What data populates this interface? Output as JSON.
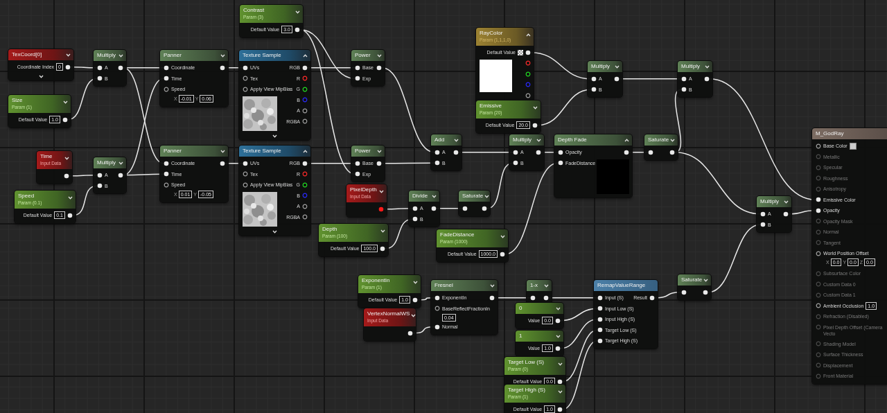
{
  "nodes": [
    {
      "kind": "input",
      "title": "TexCoord[0]",
      "expanded": false,
      "more": true,
      "outputs": [
        {
          "label": "Coordinate Index",
          "value": "0",
          "connected": true
        }
      ]
    },
    {
      "kind": "param",
      "title": "Size",
      "subtitle": "Param (1)",
      "expanded": false,
      "outputs": [
        {
          "label": "Default Value",
          "value": "1.0",
          "connected": true
        }
      ]
    },
    {
      "kind": "op",
      "title": "Multiply",
      "expanded": false,
      "inputs": [
        {
          "label": "A",
          "connected": true
        },
        {
          "label": "B",
          "connected": true
        }
      ],
      "outputs": [
        {
          "connected": true
        }
      ]
    },
    {
      "kind": "input",
      "title": "Time",
      "subtitle": "Input Data",
      "expanded": false,
      "outputs": [
        {
          "connected": true
        }
      ]
    },
    {
      "kind": "op",
      "title": "Multiply",
      "expanded": false,
      "inputs": [
        {
          "label": "A",
          "connected": true
        },
        {
          "label": "B",
          "connected": true
        }
      ],
      "outputs": [
        {
          "connected": true
        }
      ]
    },
    {
      "kind": "param",
      "title": "Speed",
      "subtitle": "Param (0.1)",
      "expanded": false,
      "outputs": [
        {
          "label": "Default Value",
          "value": "0.1",
          "connected": true
        }
      ]
    },
    {
      "kind": "op",
      "title": "Panner",
      "expanded": false,
      "inputs": [
        {
          "label": "Coordinate",
          "connected": true
        },
        {
          "label": "Time",
          "connected": true
        },
        {
          "label": "Speed",
          "connected": false,
          "fields": [
            {
              "label": "X",
              "value": "-0.01"
            },
            {
              "label": "Y",
              "value": "0.06"
            }
          ]
        }
      ],
      "outputs": [
        {
          "connected": true
        }
      ]
    },
    {
      "kind": "op",
      "title": "Panner",
      "expanded": false,
      "inputs": [
        {
          "label": "Coordinate",
          "connected": true
        },
        {
          "label": "Time",
          "connected": true
        },
        {
          "label": "Speed",
          "connected": false,
          "fields": [
            {
              "label": "X",
              "value": "0.01"
            },
            {
              "label": "Y",
              "value": "-0.05"
            }
          ]
        }
      ],
      "outputs": [
        {
          "connected": true
        }
      ]
    },
    {
      "kind": "param",
      "title": "Contrast",
      "subtitle": "Param (3)",
      "expanded": false,
      "outputs": [
        {
          "label": "Default Value",
          "value": "3.0",
          "connected": true
        }
      ]
    },
    {
      "kind": "texture",
      "title": "Texture Sample",
      "expanded": true,
      "more": true,
      "inputs": [
        {
          "label": "UVs",
          "connected": true
        },
        {
          "label": "Tex",
          "connected": false
        },
        {
          "label": "Apply View MipBias",
          "connected": false
        }
      ],
      "outputs": [
        {
          "label": "RGB",
          "connected": true
        },
        {
          "label": "R",
          "connected": false,
          "color": "#ff2a2a"
        },
        {
          "label": "G",
          "connected": false,
          "color": "#22dd22"
        },
        {
          "label": "B",
          "connected": false,
          "color": "#2a2aff"
        },
        {
          "label": "A",
          "connected": false
        },
        {
          "label": "RGBA",
          "connected": false
        }
      ]
    },
    {
      "kind": "texture",
      "title": "Texture Sample",
      "expanded": true,
      "more": true,
      "inputs": [
        {
          "label": "UVs",
          "connected": true
        },
        {
          "label": "Tex",
          "connected": false
        },
        {
          "label": "Apply View MipBias",
          "connected": false
        }
      ],
      "outputs": [
        {
          "label": "RGB",
          "connected": true
        },
        {
          "label": "R",
          "connected": false,
          "color": "#ff2a2a"
        },
        {
          "label": "G",
          "connected": false,
          "color": "#22dd22"
        },
        {
          "label": "B",
          "connected": false,
          "color": "#2a2aff"
        },
        {
          "label": "A",
          "connected": false
        },
        {
          "label": "RGBA",
          "connected": false
        }
      ]
    },
    {
      "kind": "op",
      "title": "Power",
      "expanded": false,
      "inputs": [
        {
          "label": "Base",
          "connected": true
        },
        {
          "label": "Exp",
          "connected": true
        }
      ],
      "outputs": [
        {
          "connected": true
        }
      ]
    },
    {
      "kind": "op",
      "title": "Power",
      "expanded": false,
      "inputs": [
        {
          "label": "Base",
          "connected": true
        },
        {
          "label": "Exp",
          "connected": true
        }
      ],
      "outputs": [
        {
          "connected": true
        }
      ]
    },
    {
      "kind": "op",
      "title": "Add",
      "expanded": false,
      "inputs": [
        {
          "label": "A",
          "connected": true
        },
        {
          "label": "B",
          "connected": true
        }
      ],
      "outputs": [
        {
          "connected": true
        }
      ]
    },
    {
      "kind": "input",
      "title": "PixelDepth",
      "subtitle": "Input Data",
      "expanded": false,
      "outputs": [
        {
          "connected": true,
          "color": "#ff1a1a"
        }
      ]
    },
    {
      "kind": "op",
      "title": "Divide",
      "expanded": false,
      "inputs": [
        {
          "label": "A",
          "connected": true
        },
        {
          "label": "B",
          "connected": true
        }
      ],
      "outputs": [
        {
          "connected": true
        }
      ]
    },
    {
      "kind": "op",
      "title": "Saturate",
      "expanded": false,
      "inputs": [
        {
          "connected": true
        }
      ],
      "outputs": [
        {
          "connected": true
        }
      ]
    },
    {
      "kind": "param",
      "title": "Depth",
      "subtitle": "Param (100)",
      "expanded": false,
      "outputs": [
        {
          "label": "Default Value",
          "value": "100.0",
          "connected": true
        }
      ]
    },
    {
      "kind": "param",
      "title": "FadeDistance",
      "subtitle": "Param (1000)",
      "expanded": false,
      "outputs": [
        {
          "label": "Default Value",
          "value": "1000.0",
          "connected": true
        }
      ]
    },
    {
      "kind": "vector",
      "title": "RayColor",
      "subtitle": "Param (1,1,1,0)",
      "expanded": true,
      "preview": {
        "kind": "swatch",
        "color": "#ffffff"
      },
      "outputs": [
        {
          "label": "Default Value",
          "kind": "checker",
          "connected": true
        },
        {
          "connected": false,
          "color": "#ff2a2a"
        },
        {
          "connected": false,
          "color": "#22dd22"
        },
        {
          "connected": false,
          "color": "#2a2aff"
        },
        {
          "connected": false
        }
      ]
    },
    {
      "kind": "param",
      "title": "Emissive",
      "subtitle": "Param (20)",
      "expanded": false,
      "outputs": [
        {
          "label": "Default Value",
          "value": "20.0",
          "connected": true
        }
      ]
    },
    {
      "kind": "op",
      "title": "Multiply",
      "expanded": false,
      "inputs": [
        {
          "label": "A",
          "connected": true
        },
        {
          "label": "B",
          "connected": true
        }
      ],
      "outputs": [
        {
          "connected": true
        }
      ]
    },
    {
      "kind": "op",
      "title": "Multiply",
      "expanded": false,
      "inputs": [
        {
          "label": "A",
          "connected": true
        },
        {
          "label": "B",
          "connected": true
        }
      ],
      "outputs": [
        {
          "connected": true
        }
      ]
    },
    {
      "kind": "op",
      "title": "Depth Fade",
      "expanded": true,
      "preview": {
        "kind": "swatch",
        "color": "#000000"
      },
      "inputs": [
        {
          "label": "Opacity",
          "connected": true
        },
        {
          "label": "FadeDistance",
          "connected": true
        }
      ],
      "outputs": [
        {
          "connected": true
        }
      ]
    },
    {
      "kind": "op",
      "title": "Saturate",
      "expanded": false,
      "inputs": [
        {
          "connected": true
        }
      ],
      "outputs": [
        {
          "connected": true
        }
      ]
    },
    {
      "kind": "op",
      "title": "Multiply",
      "expanded": false,
      "inputs": [
        {
          "label": "A",
          "connected": true
        },
        {
          "label": "B",
          "connected": true
        }
      ],
      "outputs": [
        {
          "connected": true
        }
      ]
    },
    {
      "kind": "op",
      "title": "Multiply",
      "expanded": false,
      "inputs": [
        {
          "label": "A",
          "connected": true
        },
        {
          "label": "B",
          "connected": true
        }
      ],
      "outputs": [
        {
          "connected": true
        }
      ]
    },
    {
      "kind": "param",
      "title": "ExponentIn",
      "subtitle": "Param (1)",
      "expanded": false,
      "outputs": [
        {
          "label": "Default Value",
          "value": "1.0",
          "connected": true
        }
      ]
    },
    {
      "kind": "input",
      "title": "VertexNormalWS",
      "subtitle": "Input Data",
      "expanded": false,
      "outputs": [
        {
          "connected": true
        }
      ]
    },
    {
      "kind": "op",
      "title": "Fresnel",
      "expanded": false,
      "inputs": [
        {
          "label": "ExponentIn",
          "connected": true
        },
        {
          "label": "BaseReflectFractionIn",
          "value": "0.04",
          "connected": false
        },
        {
          "label": "Normal",
          "connected": true
        }
      ],
      "outputs": [
        {
          "connected": true
        }
      ]
    },
    {
      "kind": "op",
      "title": "1-x",
      "expanded": false,
      "inputs": [
        {
          "connected": true
        }
      ],
      "outputs": [
        {
          "connected": true
        }
      ]
    },
    {
      "kind": "const",
      "title": "0",
      "expanded": false,
      "outputs": [
        {
          "label": "Value",
          "value": "0.0",
          "connected": true
        }
      ]
    },
    {
      "kind": "const",
      "title": "1",
      "expanded": false,
      "outputs": [
        {
          "label": "Value",
          "value": "1.0",
          "connected": true
        }
      ]
    },
    {
      "kind": "param",
      "title": "Target Low (S)",
      "subtitle": "Param (0)",
      "expanded": false,
      "outputs": [
        {
          "label": "Default Value",
          "value": "0.0",
          "connected": true
        }
      ]
    },
    {
      "kind": "param",
      "title": "Target High (S)",
      "subtitle": "Param (1)",
      "expanded": false,
      "outputs": [
        {
          "label": "Default Value",
          "value": "1.0",
          "connected": true
        }
      ]
    },
    {
      "kind": "function",
      "title": "RemapValueRange",
      "inputs": [
        {
          "label": "Input (S)",
          "connected": true
        },
        {
          "label": "Input Low (S)",
          "connected": true
        },
        {
          "label": "Input High (S)",
          "connected": true
        },
        {
          "label": "Target Low (S)",
          "connected": true
        },
        {
          "label": "Target High (S)",
          "connected": true
        }
      ],
      "outputs": [
        {
          "label": "Result",
          "connected": true
        }
      ]
    },
    {
      "kind": "op",
      "title": "Saturate",
      "expanded": false,
      "inputs": [
        {
          "connected": true
        }
      ],
      "outputs": [
        {
          "connected": true
        }
      ]
    },
    {
      "kind": "material",
      "title": "M_GodRay",
      "inputs": [
        {
          "label": "Base Color",
          "kind": "swatch",
          "color": "#cccccc",
          "connected": false,
          "disabled": false
        },
        {
          "label": "Metallic",
          "connected": false,
          "disabled": true
        },
        {
          "label": "Specular",
          "connected": false,
          "disabled": true
        },
        {
          "label": "Roughness",
          "connected": false,
          "disabled": true
        },
        {
          "label": "Anisotropy",
          "connected": false,
          "disabled": true
        },
        {
          "label": "Emissive Color",
          "connected": true,
          "disabled": false
        },
        {
          "label": "Opacity",
          "connected": true,
          "disabled": false
        },
        {
          "label": "Opacity Mask",
          "connected": false,
          "disabled": true
        },
        {
          "label": "Normal",
          "connected": false,
          "disabled": true
        },
        {
          "label": "Tangent",
          "connected": false,
          "disabled": true
        },
        {
          "label": "World Position Offset",
          "connected": false,
          "disabled": false,
          "fields": [
            {
              "label": "X",
              "value": "0.0"
            },
            {
              "label": "Y",
              "value": "0.0"
            },
            {
              "label": "Z",
              "value": "0.0"
            }
          ]
        },
        {
          "label": "Subsurface Color",
          "connected": false,
          "disabled": true
        },
        {
          "label": "Custom Data 0",
          "connected": false,
          "disabled": true
        },
        {
          "label": "Custom Data 1",
          "connected": false,
          "disabled": true
        },
        {
          "label": "Ambient Occlusion",
          "value": "1.0",
          "connected": false,
          "disabled": false
        },
        {
          "label": "Refraction (Disabled)",
          "connected": false,
          "disabled": true
        },
        {
          "label": "Pixel Depth Offset (Camera Vecto",
          "connected": false,
          "disabled": true
        },
        {
          "label": "Shading Model",
          "connected": false,
          "disabled": true
        },
        {
          "label": "Surface Thickness",
          "connected": false,
          "disabled": true
        },
        {
          "label": "Displacement",
          "connected": false,
          "disabled": true
        },
        {
          "label": "Front Material",
          "connected": false,
          "disabled": true
        }
      ]
    }
  ]
}
